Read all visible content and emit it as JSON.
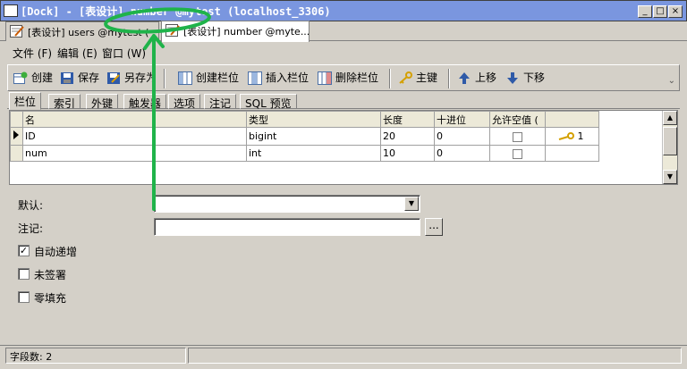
{
  "window": {
    "title": "[Dock] - [表设计] number @mytest (localhost_3306)",
    "buttons": {
      "minimize": "_",
      "maximize": "□",
      "close": "×"
    }
  },
  "doc_tabs": [
    {
      "label": "[表设计] users @mytest ("
    },
    {
      "label": "[表设计] number @myte..."
    }
  ],
  "menu": {
    "items": [
      "文件 (F)",
      "编辑 (E)",
      "窗口 (W)"
    ]
  },
  "toolbar": {
    "create": "创建",
    "save": "保存",
    "save_as": "另存为",
    "create_column": "创建栏位",
    "insert_column": "插入栏位",
    "delete_column": "删除栏位",
    "primary_key": "主键",
    "move_up": "上移",
    "move_down": "下移",
    "overflow": "⌄"
  },
  "sub_tabs": [
    "栏位",
    "索引",
    "外键",
    "触发器",
    "选项",
    "注记",
    "SQL 预览"
  ],
  "grid": {
    "columns": [
      "名",
      "类型",
      "长度",
      "十进位",
      "允许空值 ("
    ],
    "rows": [
      {
        "name": "ID",
        "type": "bigint",
        "length": "20",
        "decimals": "0",
        "pk_order": "1"
      },
      {
        "name": "num",
        "type": "int",
        "length": "10",
        "decimals": "0",
        "pk_order": ""
      }
    ]
  },
  "props": {
    "default_label": "默认:",
    "comment_label": "注记:",
    "auto_increment_label": "自动递增",
    "unsigned_label": "未签署",
    "zerofill_label": "零填充",
    "ellipsis": "...",
    "check_mark": "✓"
  },
  "status": {
    "field_count": "字段数: 2"
  },
  "colors": {
    "titlebar": "#7a96df",
    "annotation": "#1fb34a",
    "background": "#d4d0c8"
  }
}
